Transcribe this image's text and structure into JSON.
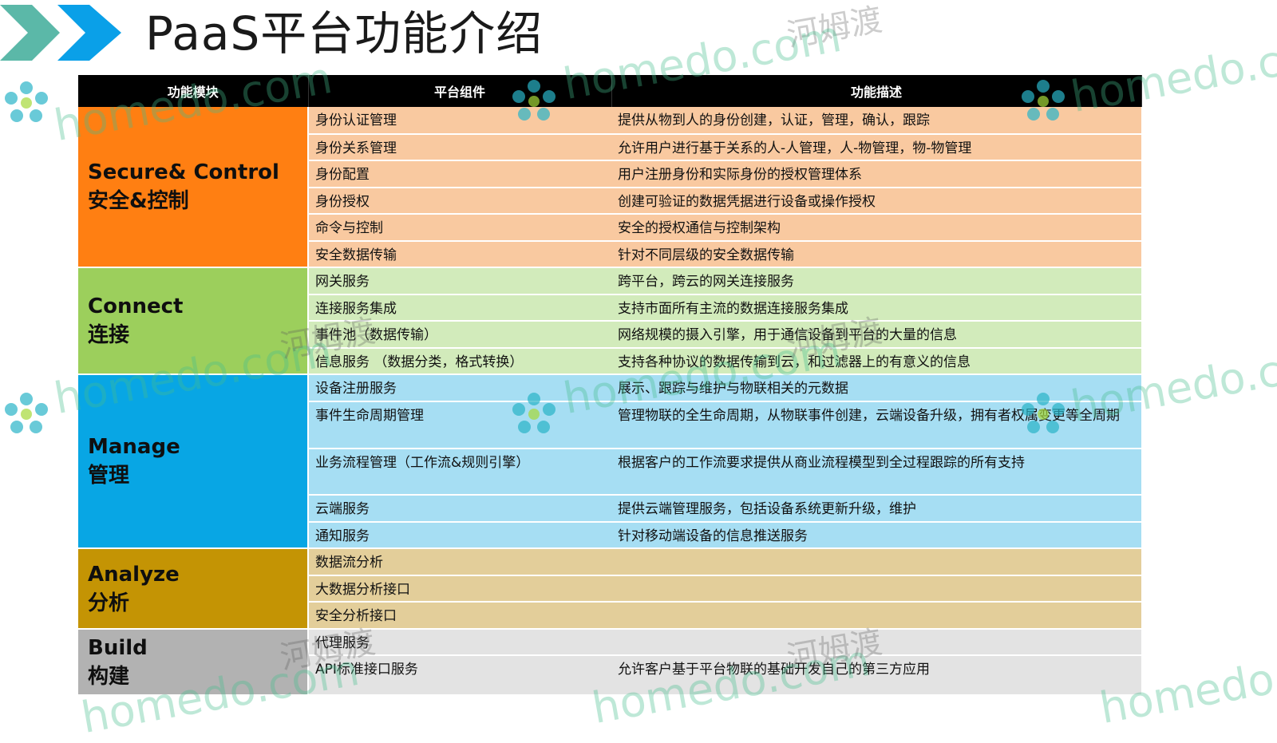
{
  "page": {
    "title": "PaaS平台功能介绍"
  },
  "watermark": {
    "en": "homedo.com",
    "zh": "河姆渡"
  },
  "table": {
    "headers": [
      "功能模块",
      "平台组件",
      "功能描述"
    ],
    "groups": [
      {
        "module_en": "Secure& Control",
        "module_zh": "安全&控制",
        "rows": [
          [
            "身份认证管理",
            "提供从物到人的身份创建，认证，管理，确认，跟踪"
          ],
          [
            "身份关系管理",
            "允许用户进行基于关系的人-人管理，人-物管理，物-物管理"
          ],
          [
            "身份配置",
            "用户注册身份和实际身份的授权管理体系"
          ],
          [
            "身份授权",
            "创建可验证的数据凭据进行设备或操作授权"
          ],
          [
            "命令与控制",
            "安全的授权通信与控制架构"
          ],
          [
            "安全数据传输",
            "针对不同层级的安全数据传输"
          ]
        ]
      },
      {
        "module_en": "Connect",
        "module_zh": "连接",
        "rows": [
          [
            "网关服务",
            "跨平台，跨云的网关连接服务"
          ],
          [
            "连接服务集成",
            "支持市面所有主流的数据连接服务集成"
          ],
          [
            "事件池（数据传输）",
            "网络规模的摄入引擎，用于通信设备到平台的大量的信息"
          ],
          [
            "信息服务 （数据分类，格式转换）",
            "支持各种协议的数据传输到云，和过滤器上的有意义的信息"
          ]
        ]
      },
      {
        "module_en": "Manage",
        "module_zh": "管理",
        "rows": [
          [
            "设备注册服务",
            "展示、跟踪与维护与物联相关的元数据"
          ],
          [
            "事件生命周期管理",
            "管理物联的全生命周期，从物联事件创建，云端设备升级，拥有者权属变更等全周期"
          ],
          [
            "业务流程管理（工作流&规则引擎）",
            "根据客户的工作流要求提供从商业流程模型到全过程跟踪的所有支持"
          ],
          [
            "云端服务",
            "提供云端管理服务，包括设备系统更新升级，维护"
          ],
          [
            "通知服务",
            "针对移动端设备的信息推送服务"
          ]
        ]
      },
      {
        "module_en": "Analyze",
        "module_zh": "分析",
        "rows": [
          [
            "数据流分析",
            ""
          ],
          [
            "大数据分析接口",
            ""
          ],
          [
            "安全分析接口",
            ""
          ]
        ]
      },
      {
        "module_en": "Build",
        "module_zh": "构建",
        "rows": [
          [
            "代理服务",
            ""
          ],
          [
            "API标准接口服务",
            "允许客户基于平台物联的基础开发自己的第三方应用"
          ]
        ]
      }
    ]
  }
}
